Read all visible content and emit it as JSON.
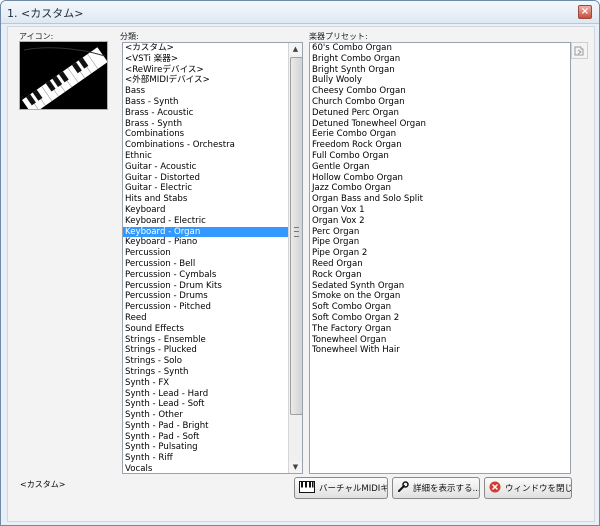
{
  "window": {
    "title": "1. <カスタム>"
  },
  "labels": {
    "icon": "アイコン:",
    "category": "分類:",
    "preset": "楽器プリセット:"
  },
  "categories": [
    "<カスタム>",
    "<VSTi 楽器>",
    "<ReWireデバイス>",
    "<外部MIDIデバイス>",
    "Bass",
    "Bass - Synth",
    "Brass - Acoustic",
    "Brass - Synth",
    "Combinations",
    "Combinations - Orchestra",
    "Ethnic",
    "Guitar - Acoustic",
    "Guitar - Distorted",
    "Guitar - Electric",
    "Hits and Stabs",
    "Keyboard",
    "Keyboard - Electric",
    "Keyboard - Organ",
    "Keyboard - Piano",
    "Percussion",
    "Percussion - Bell",
    "Percussion - Cymbals",
    "Percussion - Drum Kits",
    "Percussion - Drums",
    "Percussion - Pitched",
    "Reed",
    "Sound Effects",
    "Strings - Ensemble",
    "Strings - Plucked",
    "Strings - Solo",
    "Strings - Synth",
    "Synth - FX",
    "Synth - Lead - Hard",
    "Synth - Lead - Soft",
    "Synth - Other",
    "Synth - Pad - Bright",
    "Synth - Pad - Soft",
    "Synth - Pulsating",
    "Synth - Riff",
    "Vocals"
  ],
  "selected_category": "Keyboard - Organ",
  "presets": [
    "60's Combo Organ",
    "Bright Combo Organ",
    "Bright Synth Organ",
    "Bully Wooly",
    "Cheesy Combo Organ",
    "Church Combo Organ",
    "Detuned Perc Organ",
    "Detuned Tonewheel Organ",
    "Eerie Combo Organ",
    "Freedom Rock Organ",
    "Full Combo Organ",
    "Gentle Organ",
    "Hollow Combo Organ",
    "Jazz Combo Organ",
    "Organ Bass and Solo Split",
    "Organ Vox 1",
    "Organ Vox 2",
    "Perc Organ",
    "Pipe Organ",
    "Pipe Organ 2",
    "Reed Organ",
    "Rock Organ",
    "Sedated Synth Organ",
    "Smoke on the Organ",
    "Soft Combo Organ",
    "Soft Combo Organ 2",
    "The Factory Organ",
    "Tonewheel Organ",
    "Tonewheel With Hair"
  ],
  "status_text": "<カスタム>",
  "buttons": {
    "virtual_midi": "バーチャルMIDIキーボード",
    "details": "詳細を表示する...",
    "close": "ウィンドウを閉じる"
  },
  "icons": {
    "keyboard_thumbnail": "piano-keys-image",
    "virtual_midi": "piano-keyboard-icon",
    "details": "wrench-icon",
    "close": "red-x-circle-icon",
    "refresh": "refresh-icon"
  }
}
